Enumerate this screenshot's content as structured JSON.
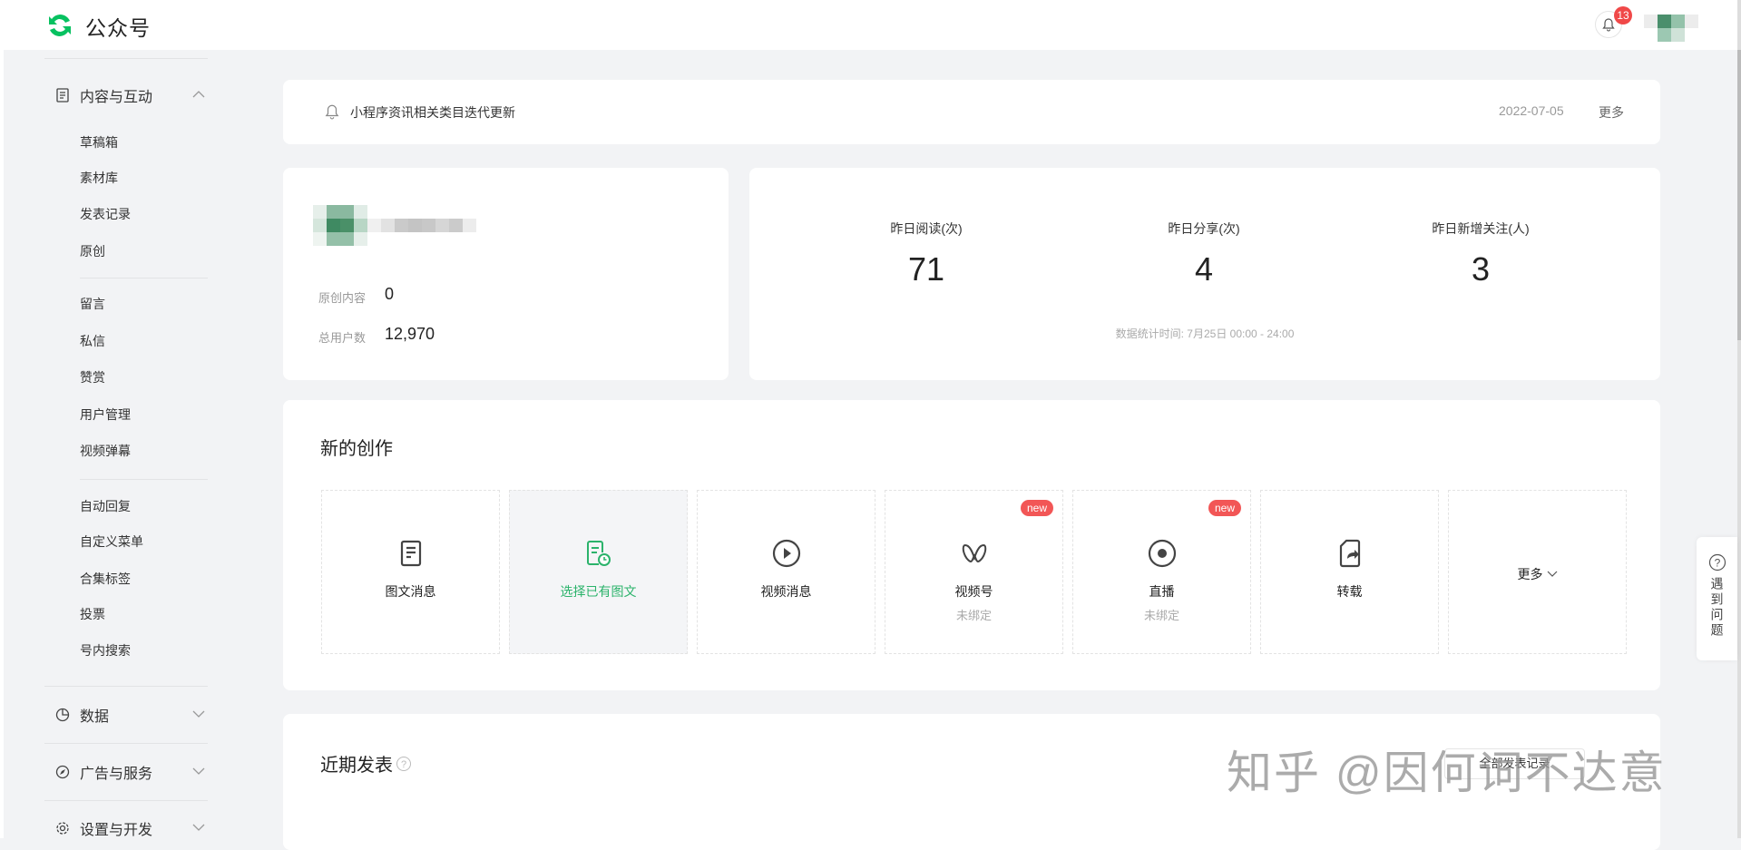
{
  "header": {
    "brand": "公众号",
    "notification_count": "13"
  },
  "sidebar": {
    "sections": [
      {
        "label": "内容与互动",
        "items": [
          "草稿箱",
          "素材库",
          "发表记录",
          "原创",
          "留言",
          "私信",
          "赞赏",
          "用户管理",
          "视频弹幕",
          "自动回复",
          "自定义菜单",
          "合集标签",
          "投票",
          "号内搜索"
        ]
      },
      {
        "label": "数据"
      },
      {
        "label": "广告与服务"
      },
      {
        "label": "设置与开发"
      }
    ]
  },
  "notice": {
    "text": "小程序资讯相关类目迭代更新",
    "date": "2022-07-05",
    "more": "更多"
  },
  "account": {
    "original_label": "原创内容",
    "original_value": "0",
    "users_label": "总用户数",
    "users_value": "12,970"
  },
  "stats": {
    "items": [
      {
        "label": "昨日阅读(次)",
        "value": "71"
      },
      {
        "label": "昨日分享(次)",
        "value": "4"
      },
      {
        "label": "昨日新增关注(人)",
        "value": "3"
      }
    ],
    "footnote": "数据统计时间: 7月25日 00:00 - 24:00"
  },
  "create": {
    "title": "新的创作",
    "tiles": [
      {
        "label": "图文消息"
      },
      {
        "label": "选择已有图文"
      },
      {
        "label": "视频消息"
      },
      {
        "label": "视频号",
        "sub": "未绑定",
        "badge": "new"
      },
      {
        "label": "直播",
        "sub": "未绑定",
        "badge": "new"
      },
      {
        "label": "转载"
      },
      {
        "label": "更多"
      }
    ]
  },
  "recent": {
    "title": "近期发表",
    "all_button": "全部发表记录"
  },
  "help": {
    "label": "遇到问题"
  },
  "watermark": "知乎 @因何词不达意",
  "colors": {
    "accent": "#07c160",
    "badge": "#f04848"
  }
}
